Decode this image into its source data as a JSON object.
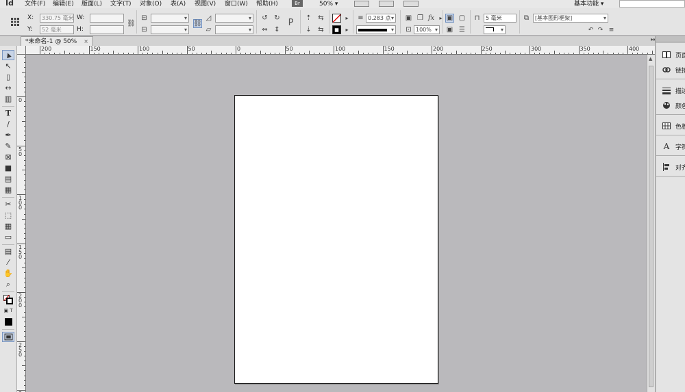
{
  "app": {
    "logo": "Id"
  },
  "menu": [
    {
      "label": "文件(F)"
    },
    {
      "label": "编辑(E)"
    },
    {
      "label": "版面(L)"
    },
    {
      "label": "文字(T)"
    },
    {
      "label": "对象(O)"
    },
    {
      "label": "表(A)"
    },
    {
      "label": "视图(V)"
    },
    {
      "label": "窗口(W)"
    },
    {
      "label": "帮助(H)"
    }
  ],
  "bridge_label": "Br",
  "zoom_display": "50%",
  "workspace": "基本功能",
  "control": {
    "x_label": "X:",
    "x_value": "330.75 毫米",
    "y_label": "Y:",
    "y_value": "52 毫米",
    "w_label": "W:",
    "h_label": "H:",
    "stroke_weight": "0.283 点",
    "opacity": "100%",
    "offset": "5 毫米",
    "object_style": "[基本图形框架]",
    "fx": "fx",
    "type_p": "P"
  },
  "document_tab": {
    "title": "*未命名-1 @ 50%",
    "close": "×"
  },
  "ruler": {
    "h_labels": [
      "200",
      "150",
      "100",
      "50",
      "0",
      "50",
      "100",
      "150",
      "200",
      "250",
      "300",
      "350",
      "400"
    ],
    "v_labels": [
      "0",
      "5\n0",
      "1\n0\n0",
      "1\n5\n0",
      "2\n0\n0",
      "2\n5\n0",
      "3"
    ]
  },
  "panels": [
    {
      "label": "页面",
      "icon": "pages-icon"
    },
    {
      "label": "链接",
      "icon": "links-icon"
    },
    {
      "label": "描边",
      "icon": "stroke-icon"
    },
    {
      "label": "颜色",
      "icon": "color-icon"
    },
    {
      "label": "色板",
      "icon": "swatches-icon"
    },
    {
      "label": "字符",
      "icon": "character-icon"
    },
    {
      "label": "对齐",
      "icon": "align-icon"
    }
  ],
  "tools": [
    {
      "name": "selection-tool",
      "glyph": "▲"
    },
    {
      "name": "direct-selection-tool",
      "glyph": "↖"
    },
    {
      "name": "page-tool",
      "glyph": "▯"
    },
    {
      "name": "gap-tool",
      "glyph": "↔"
    },
    {
      "name": "content-collector-tool",
      "glyph": "▥"
    },
    {
      "name": "type-tool",
      "glyph": "T"
    },
    {
      "name": "line-tool",
      "glyph": "/"
    },
    {
      "name": "pen-tool",
      "glyph": "✒"
    },
    {
      "name": "pencil-tool",
      "glyph": "✎"
    },
    {
      "name": "rectangle-frame-tool",
      "glyph": "⊠"
    },
    {
      "name": "rectangle-tool",
      "glyph": "■"
    },
    {
      "name": "horizontal-grid-tool",
      "glyph": "▤"
    },
    {
      "name": "vertical-grid-tool",
      "glyph": "▦"
    },
    {
      "name": "scissors-tool",
      "glyph": "✂"
    },
    {
      "name": "free-transform-tool",
      "glyph": "⬚"
    },
    {
      "name": "gradient-swatch-tool",
      "glyph": "▦"
    },
    {
      "name": "gradient-feather-tool",
      "glyph": "▭"
    },
    {
      "name": "note-tool",
      "glyph": "▤"
    },
    {
      "name": "eyedropper-tool",
      "glyph": "⁄"
    },
    {
      "name": "hand-tool",
      "glyph": "✋"
    },
    {
      "name": "zoom-tool",
      "glyph": "⌕"
    }
  ],
  "colors": {
    "accent": "#6f8fbf",
    "pasteboard": "#bab9bc",
    "page": "#ffffff"
  }
}
